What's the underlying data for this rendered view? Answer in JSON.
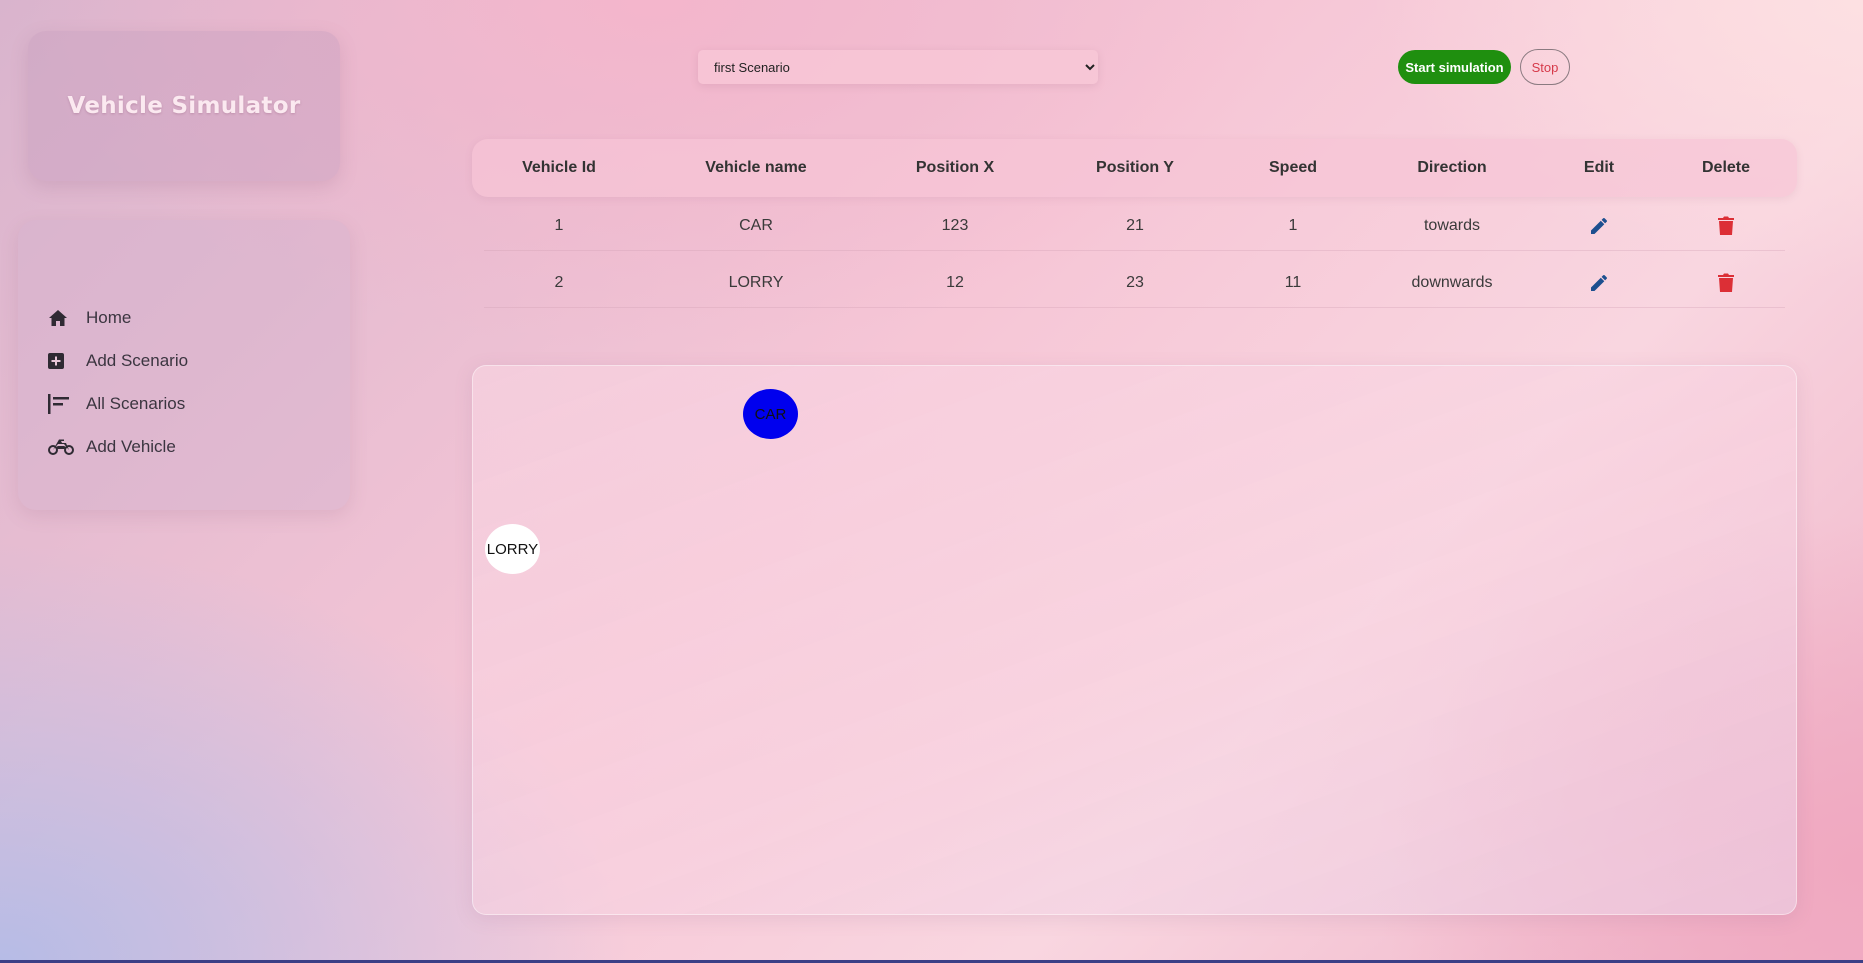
{
  "app": {
    "title": "Vehicle Simulator"
  },
  "sidebar": {
    "items": [
      {
        "label": "Home",
        "icon": "home-icon"
      },
      {
        "label": "Add Scenario",
        "icon": "plus-square-icon"
      },
      {
        "label": "All Scenarios",
        "icon": "list-icon"
      },
      {
        "label": "Add Vehicle",
        "icon": "motorcycle-icon"
      }
    ]
  },
  "controls": {
    "scenario_selected": "first Scenario",
    "start_label": "Start simulation",
    "stop_label": "Stop"
  },
  "table": {
    "headers": [
      "Vehicle Id",
      "Vehicle name",
      "Position X",
      "Position Y",
      "Speed",
      "Direction",
      "Edit",
      "Delete"
    ],
    "rows": [
      {
        "id": "1",
        "name": "CAR",
        "x": "123",
        "y": "21",
        "speed": "1",
        "direction": "towards"
      },
      {
        "id": "2",
        "name": "LORRY",
        "x": "12",
        "y": "23",
        "speed": "11",
        "direction": "downwards"
      }
    ]
  },
  "canvas": {
    "vehicles": [
      {
        "label": "CAR",
        "color": "#0000ee"
      },
      {
        "label": "LORRY",
        "color": "#ffffff"
      }
    ]
  },
  "colors": {
    "start_button": "#1f8f0f",
    "stop_text": "#d63a4a",
    "edit_icon": "#1d4f8f",
    "delete_icon": "#dc2f36"
  }
}
